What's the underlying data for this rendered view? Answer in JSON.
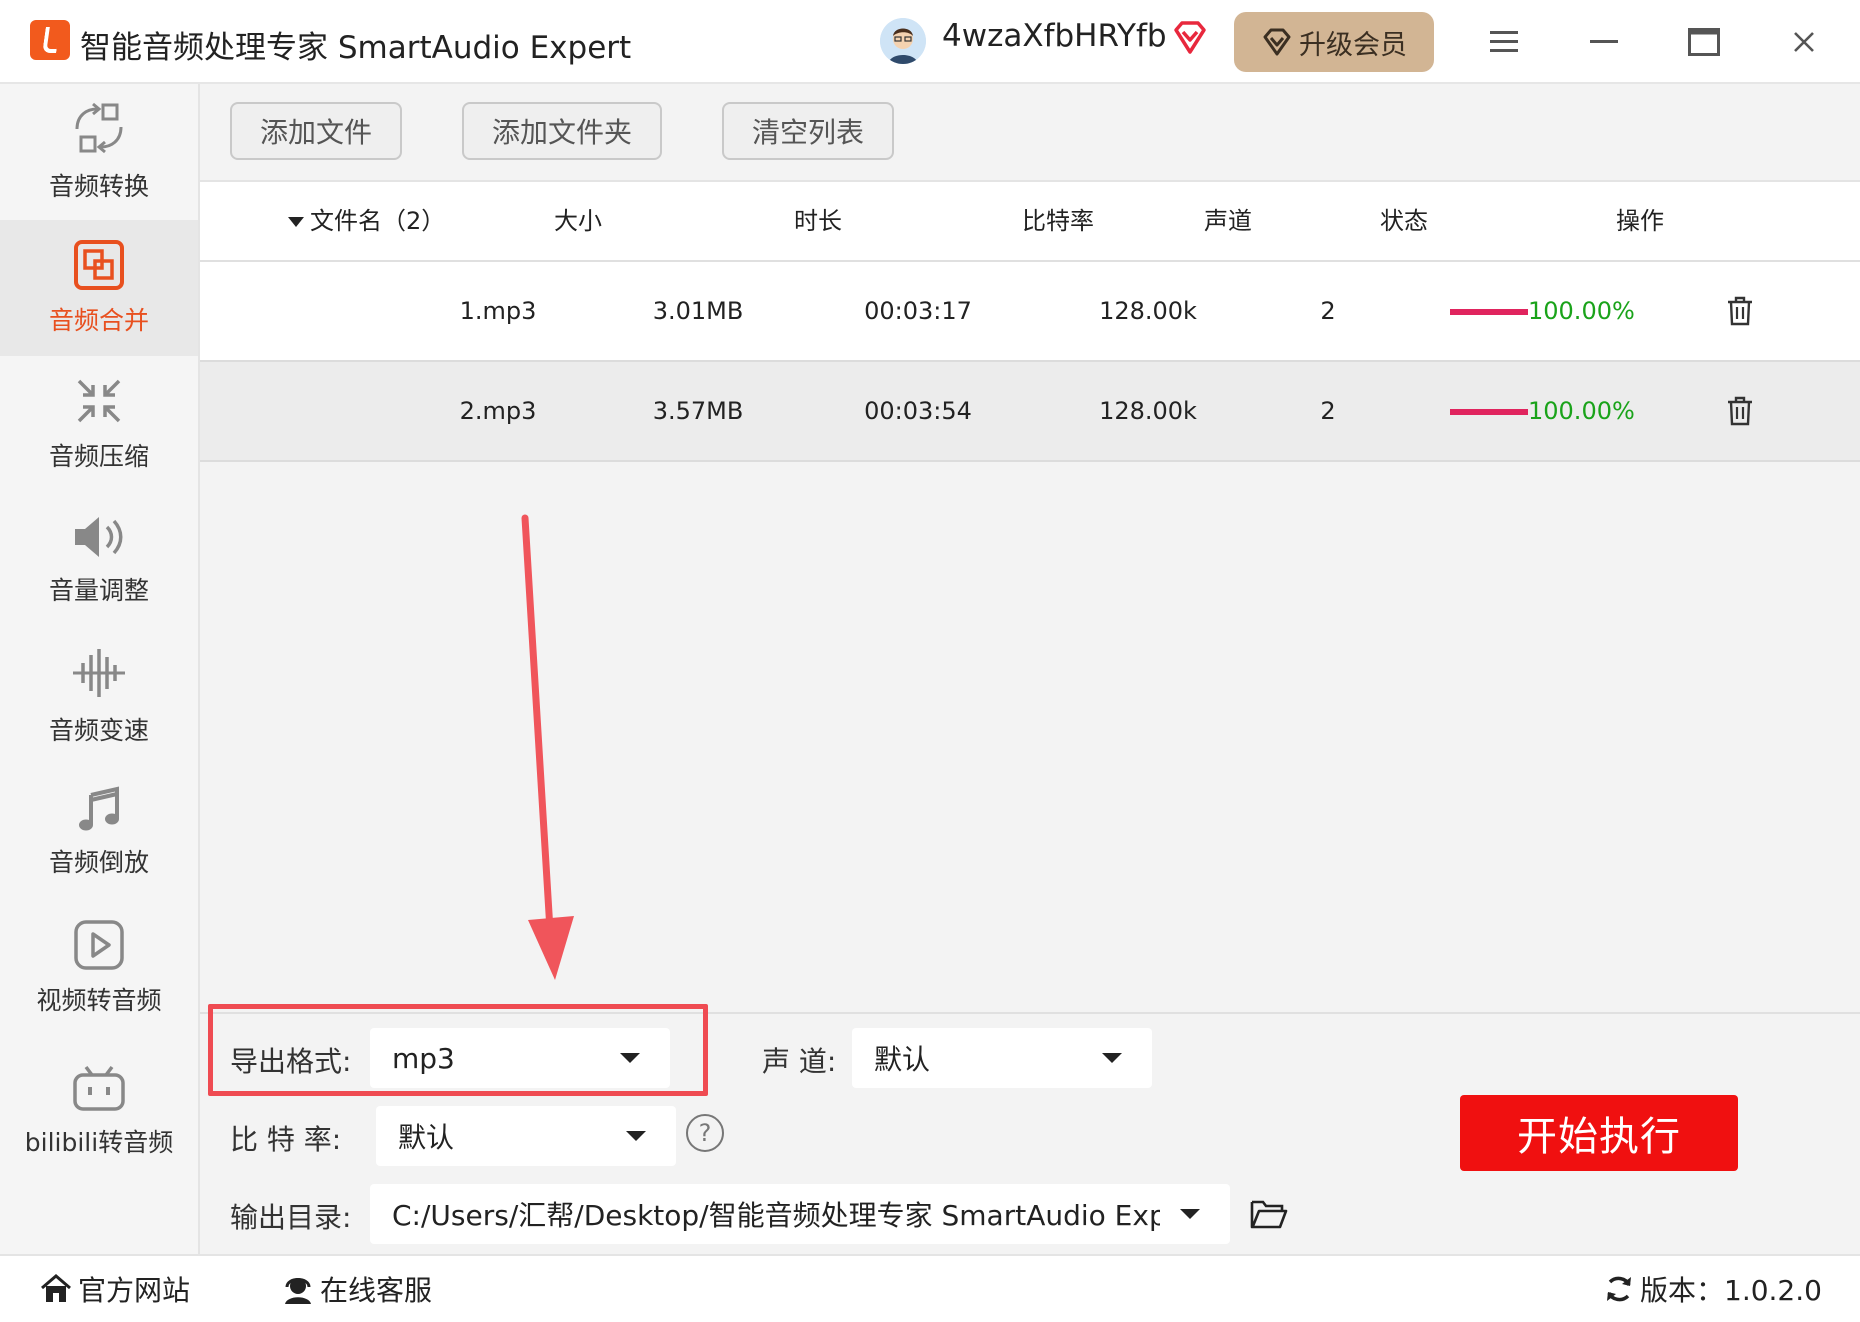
{
  "app": {
    "title": "智能音频处理专家 SmartAudio Expert"
  },
  "user": {
    "name": "4wzaXfbHRYfb",
    "upgrade_label": "升级会员"
  },
  "sidebar": {
    "items": [
      {
        "label": "音频转换",
        "icon": "convert-icon"
      },
      {
        "label": "音频合并",
        "icon": "merge-icon",
        "active": true
      },
      {
        "label": "音频压缩",
        "icon": "compress-icon"
      },
      {
        "label": "音量调整",
        "icon": "volume-icon"
      },
      {
        "label": "音频变速",
        "icon": "speed-icon"
      },
      {
        "label": "音频倒放",
        "icon": "music-note-icon"
      },
      {
        "label": "视频转音频",
        "icon": "video-play-icon"
      },
      {
        "label": "bilibili转音频",
        "icon": "bilibili-icon"
      }
    ]
  },
  "toolbar": {
    "add_file": "添加文件",
    "add_folder": "添加文件夹",
    "clear_list": "清空列表"
  },
  "table": {
    "headers": {
      "name": "文件名（2）",
      "size": "大小",
      "duration": "时长",
      "bitrate": "比特率",
      "channels": "声道",
      "status": "状态",
      "action": "操作"
    },
    "rows": [
      {
        "name": "1.mp3",
        "size": "3.01MB",
        "duration": "00:03:17",
        "bitrate": "128.00k",
        "channels": "2",
        "status": "100.00%",
        "progress": 1.0
      },
      {
        "name": "2.mp3",
        "size": "3.57MB",
        "duration": "00:03:54",
        "bitrate": "128.00k",
        "channels": "2",
        "status": "100.00%",
        "progress": 1.0
      }
    ]
  },
  "settings": {
    "format_label": "导出格式:",
    "format_value": "mp3",
    "channel_label": "声 道:",
    "channel_value": "默认",
    "bitrate_label": "比 特 率:",
    "bitrate_value": "默认",
    "output_label": "输出目录:",
    "output_value": "C:/Users/汇帮/Desktop/智能音频处理专家 SmartAudio Exp"
  },
  "start_label": "开始执行",
  "footer": {
    "website": "官方网站",
    "support": "在线客服",
    "version": "版本：1.0.2.0"
  },
  "colors": {
    "accent": "#e8501f",
    "start": "#f01010",
    "progress": "#e0245e",
    "status_text": "#1aa31a",
    "highlight": "#ef4b52",
    "upgrade": "#d2b594"
  }
}
